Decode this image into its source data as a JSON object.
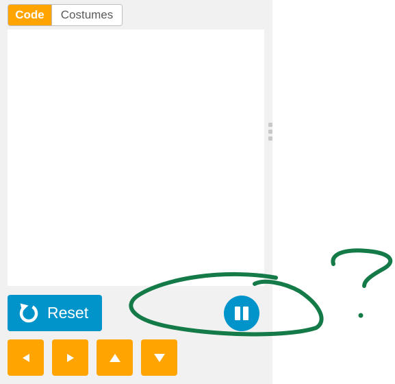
{
  "tabs": {
    "code_label": "Code",
    "costumes_label": "Costumes"
  },
  "controls": {
    "reset_label": "Reset",
    "reset_icon": "rotate-cw-icon",
    "pause_icon": "pause-icon"
  },
  "arrows": [
    "arrow-left-icon",
    "arrow-right-icon",
    "arrow-up-icon",
    "arrow-down-icon"
  ],
  "colors": {
    "panel_bg": "#f1f1f1",
    "accent_orange": "#ffa400",
    "accent_blue": "#0094ca",
    "annotation_green": "#137a48"
  },
  "annotation": {
    "question_mark": "?"
  }
}
